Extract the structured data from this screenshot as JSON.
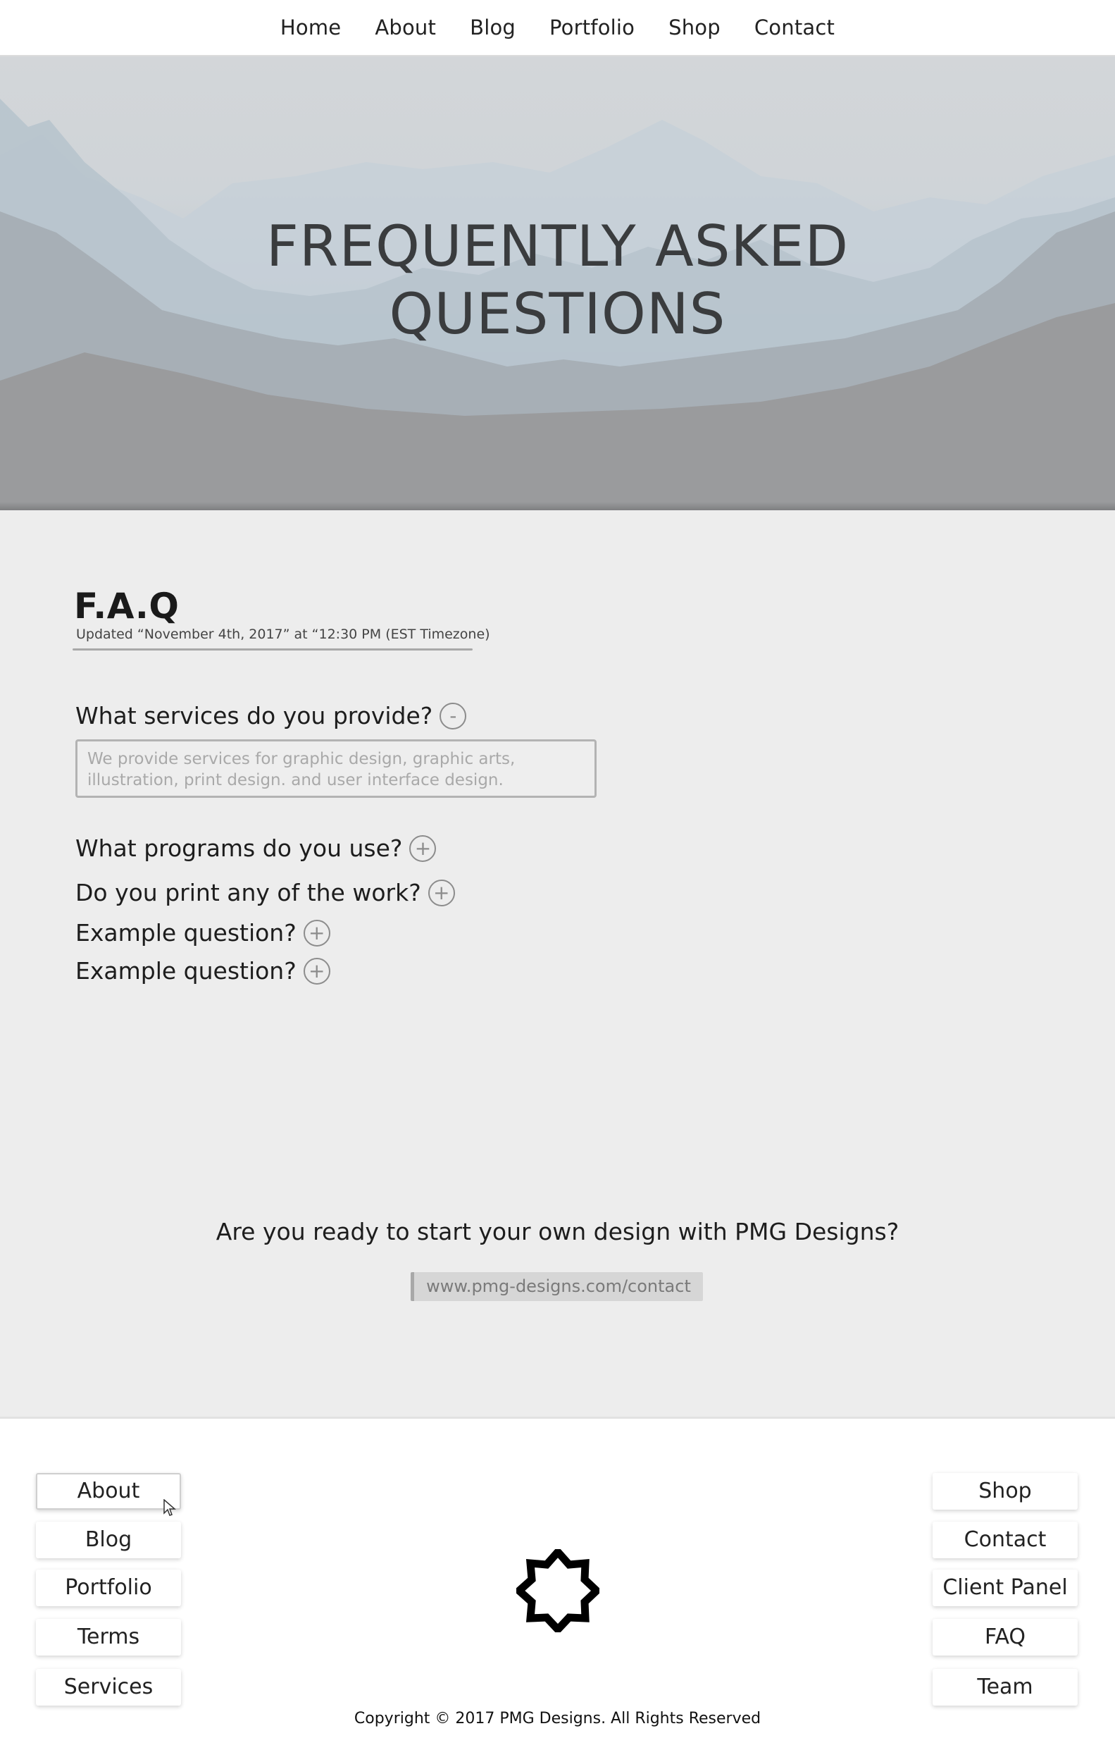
{
  "nav": {
    "items": [
      "Home",
      "About",
      "Blog",
      "Portfolio",
      "Shop",
      "Contact"
    ]
  },
  "hero": {
    "title_line1": "FREQUENTLY ASKED",
    "title_line2": "QUESTIONS"
  },
  "faq": {
    "heading": "F.A.Q",
    "updated": "Updated “November 4th, 2017” at “12:30 PM (EST Timezone)",
    "questions": [
      {
        "text": "What services do you provide?",
        "toggle": "-",
        "expanded": true,
        "answer": "We provide services for graphic design, graphic arts, illustration, print design. and user interface design."
      },
      {
        "text": "What programs do you use?",
        "toggle": "+",
        "expanded": false
      },
      {
        "text": "Do you print any of the work?",
        "toggle": "+",
        "expanded": false
      },
      {
        "text": "Example question?",
        "toggle": "+",
        "expanded": false
      },
      {
        "text": "Example question?",
        "toggle": "+",
        "expanded": false
      }
    ]
  },
  "cta": {
    "text": "Are you ready to start your own design with PMG Designs?",
    "link": "www.pmg-designs.com/contact"
  },
  "footer": {
    "left_links": [
      "About",
      "Blog",
      "Portfolio",
      "Terms",
      "Services"
    ],
    "right_links": [
      "Shop",
      "Contact",
      "Client Panel",
      "FAQ",
      "Team"
    ],
    "logo_icon": "eight-point-star-icon",
    "copyright": "Copyright © 2017 PMG Designs. All Rights Reserved"
  },
  "colors": {
    "main_bg": "#ededed",
    "text": "#1d1d1d",
    "muted": "#a9a9a9"
  }
}
